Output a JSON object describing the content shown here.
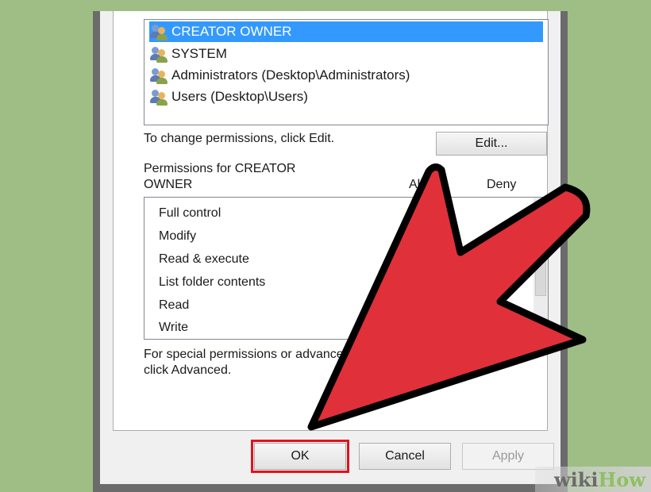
{
  "groups": {
    "items": [
      {
        "label": "CREATOR OWNER",
        "selected": true
      },
      {
        "label": "SYSTEM",
        "selected": false
      },
      {
        "label": "Administrators (Desktop\\Administrators)",
        "selected": false
      },
      {
        "label": "Users (Desktop\\Users)",
        "selected": false
      }
    ]
  },
  "change_hint": "To change permissions, click Edit.",
  "edit_button": "Edit...",
  "permissions": {
    "header_line1": "Permissions for CREATOR",
    "header_line2": "OWNER",
    "allow_header": "Allow",
    "deny_header": "Deny",
    "rows": [
      "Full control",
      "Modify",
      "Read & execute",
      "List folder contents",
      "Read",
      "Write"
    ]
  },
  "advanced_hint_line1": "For special permissions or advanced settings,",
  "advanced_hint_line2": "click Advanced.",
  "buttons": {
    "ok": "OK",
    "cancel": "Cancel",
    "apply": "Apply"
  },
  "watermark": {
    "part1": "wiki",
    "part2": "How"
  },
  "colors": {
    "highlight": "#e0121f",
    "arrow": "#e0303a",
    "selection": "#3399ff",
    "background": "#9ebe86"
  }
}
